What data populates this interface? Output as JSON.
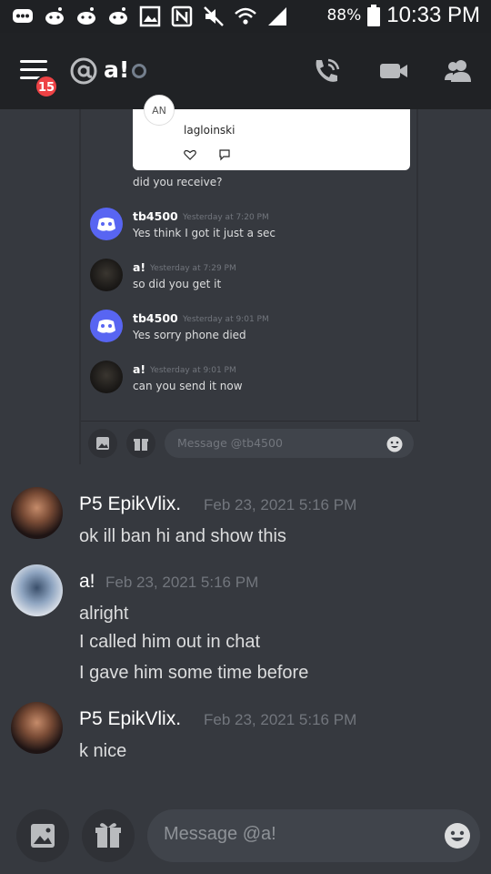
{
  "status_bar": {
    "battery_pct": "88%",
    "time": "10:33 PM"
  },
  "header": {
    "badge_count": "15",
    "channel_name": "a!"
  },
  "embed": {
    "card_avatar": "AN",
    "card_username": "lagloinski",
    "prev_text": "did you receive?",
    "messages": [
      {
        "author": "tb4500",
        "time": "Yesterday at 7:20 PM",
        "text": "Yes think I got it just a sec"
      },
      {
        "author": "a!",
        "time": "Yesterday at 7:29 PM",
        "text": "so did you get it"
      },
      {
        "author": "tb4500",
        "time": "Yesterday at 9:01 PM",
        "text": "Yes sorry phone died"
      },
      {
        "author": "a!",
        "time": "Yesterday at 9:01 PM",
        "text": "can you send it now"
      }
    ],
    "input_placeholder": "Message @tb4500"
  },
  "chat": {
    "messages": [
      {
        "author": "P5 EpikVlix.",
        "time": "Feb 23, 2021 5:16 PM",
        "lines": [
          "ok ill ban hi and show this"
        ]
      },
      {
        "author": "a!",
        "time": "Feb 23, 2021 5:16 PM",
        "lines": [
          "alright",
          "I called him out in chat",
          "I gave him some time before"
        ]
      },
      {
        "author": "P5 EpikVlix.",
        "time": "Feb 23, 2021 5:16 PM",
        "lines": [
          "k nice"
        ]
      }
    ]
  },
  "composer": {
    "placeholder": "Message @a!"
  },
  "colors": {
    "background": "#36393f",
    "header": "#202225",
    "badge": "#ed4245",
    "blurple": "#5865f2"
  },
  "icons": [
    "image-icon",
    "gift-icon",
    "emoji-icon",
    "call-icon",
    "video-icon",
    "members-icon",
    "at-icon",
    "menu-icon"
  ]
}
